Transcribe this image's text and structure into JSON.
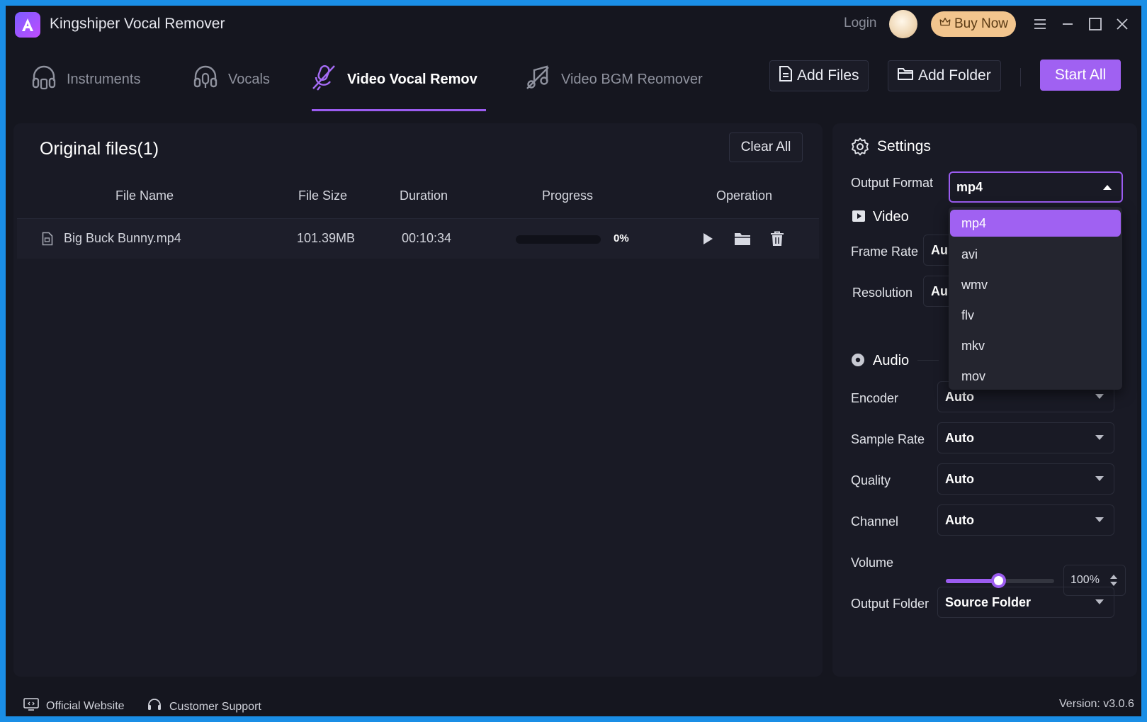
{
  "app": {
    "title": "Kingshiper Vocal Remover",
    "login_label": "Login",
    "buy_now_label": "Buy Now"
  },
  "tabs": [
    {
      "label": "Instruments",
      "icon": "headphones-icon",
      "active": false
    },
    {
      "label": "Vocals",
      "icon": "headset-mic-icon",
      "active": false
    },
    {
      "label": "Video Vocal Remov",
      "icon": "mic-off-icon",
      "active": true
    },
    {
      "label": "Video BGM Reomover",
      "icon": "music-off-icon",
      "active": false
    }
  ],
  "toolbar": {
    "add_files_label": "Add Files",
    "add_folder_label": "Add Folder",
    "start_all_label": "Start All"
  },
  "files_panel": {
    "title": "Original files(1)",
    "clear_all_label": "Clear All",
    "columns": [
      "File Name",
      "File Size",
      "Duration",
      "Progress",
      "Operation"
    ],
    "rows": [
      {
        "file_name": "Big Buck Bunny.mp4",
        "file_size": "101.39MB",
        "duration": "00:10:34",
        "progress_text": "0%",
        "progress": 0
      }
    ]
  },
  "settings": {
    "title": "Settings",
    "output_format_label": "Output Format",
    "output_format_value": "mp4",
    "format_options": [
      "mp4",
      "avi",
      "wmv",
      "flv",
      "mkv",
      "mov"
    ],
    "video_section": "Video",
    "frame_rate_label": "Frame Rate",
    "frame_rate_value": "Au",
    "resolution_label": "Resolution",
    "resolution_value": "Au",
    "audio_section": "Audio",
    "encoder_label": "Encoder",
    "encoder_value": "Auto",
    "sample_rate_label": "Sample Rate",
    "sample_rate_value": "Auto",
    "quality_label": "Quality",
    "quality_value": "Auto",
    "channel_label": "Channel",
    "channel_value": "Auto",
    "volume_label": "Volume",
    "volume_value": "100%",
    "volume_level": 0.5,
    "output_folder_label": "Output Folder",
    "output_folder_value": "Source Folder"
  },
  "footer": {
    "official_website_label": "Official Website",
    "customer_support_label": "Customer Support",
    "version": "Version: v3.0.6"
  },
  "colors": {
    "accent": "#9b5cf0",
    "background": "#15161f",
    "panel": "#191a25",
    "buy_now": "#f2c58e"
  }
}
